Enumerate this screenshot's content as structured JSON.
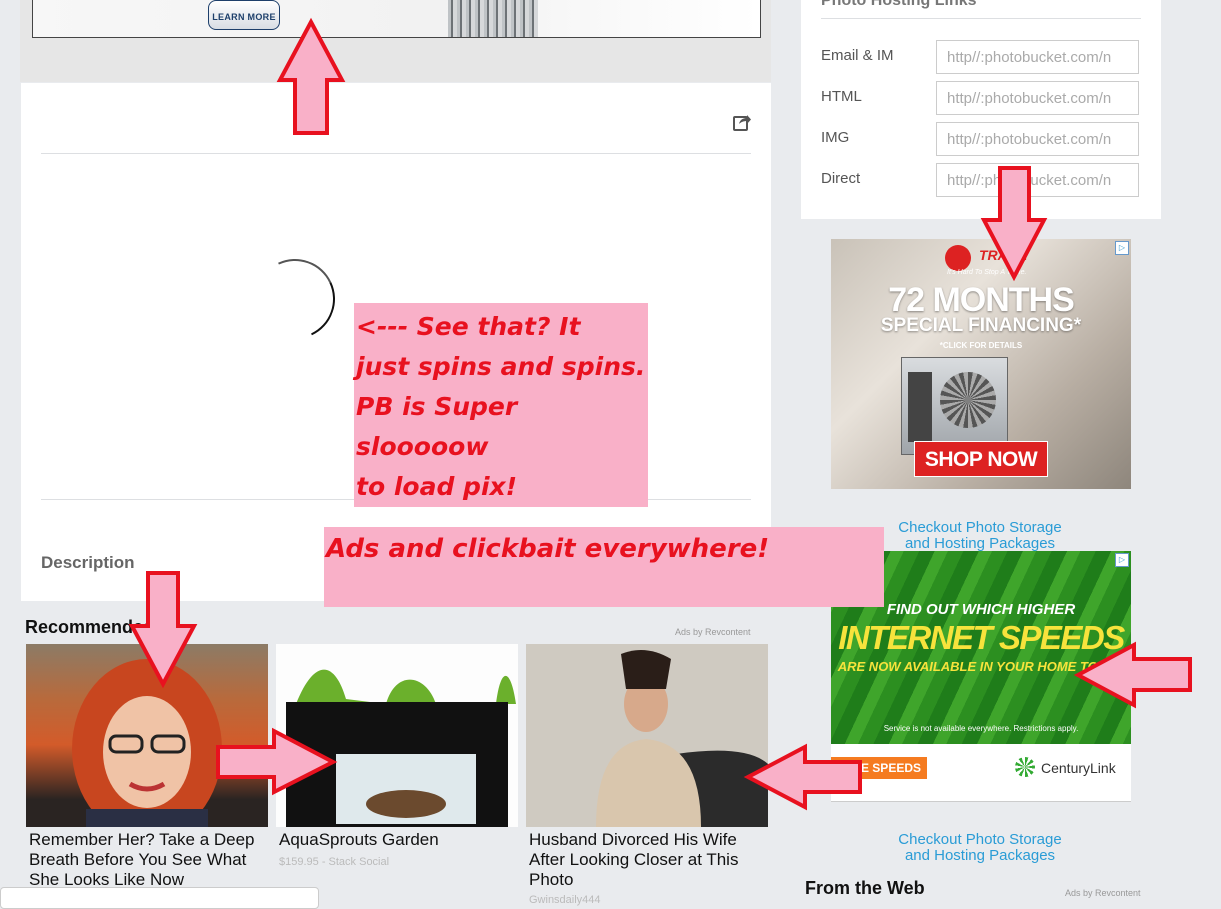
{
  "top_ad": {
    "button_label": "LEARN MORE"
  },
  "photo": {
    "description_label": "Description"
  },
  "hosting_links": {
    "title": "Photo Hosting Links",
    "rows": [
      {
        "label": "Email & IM",
        "value": "http//:photobucket.com/n"
      },
      {
        "label": "HTML",
        "value": "http//:photobucket.com/n"
      },
      {
        "label": "IMG",
        "value": "http//:photobucket.com/n"
      },
      {
        "label": "Direct",
        "value": "http//:photobucket.com/n"
      }
    ]
  },
  "trane_ad": {
    "brand": "TRANE",
    "tagline": "It's Hard To Stop A Trane.",
    "headline": "72 MONTHS",
    "subheadline": "SPECIAL FINANCING*",
    "fine_print": "*CLICK FOR DETAILS",
    "button": "SHOP NOW"
  },
  "checkout_link_1": {
    "line1": "Checkout Photo Storage",
    "line2": "and Hosting Packages"
  },
  "centurylink_ad": {
    "line1": "FIND OUT WHICH HIGHER",
    "line2": "INTERNET SPEEDS",
    "line3": "ARE NOW AVAILABLE IN YOUR HOME TODAY",
    "note": "Service is not available everywhere. Restrictions apply.",
    "button": "E SPEEDS",
    "brand": "CenturyLink"
  },
  "checkout_link_2": {
    "line1": "Checkout Photo Storage",
    "line2": "and Hosting Packages"
  },
  "recommended": {
    "title": "Recommended",
    "ads_by": "Ads by Revcontent",
    "items": [
      {
        "title": "Remember Her? Take a Deep Breath Before You See What She Looks Like Now",
        "sub": ""
      },
      {
        "title": "AquaSprouts Garden",
        "sub": "$159.95 - Stack Social"
      },
      {
        "title": "Husband Divorced His Wife After Looking Closer at This Photo",
        "sub": "Gwinsdaily444"
      }
    ]
  },
  "from_web": {
    "title": "From the Web",
    "ads_by": "Ads by Revcontent"
  },
  "annotations": {
    "note1_lines": [
      "<--- See that? It",
      "just spins and spins.",
      "PB is Super slooooow",
      "to load pix!"
    ],
    "note2": "Ads and clickbait everywhere!"
  },
  "colors": {
    "annotation_bg": "#f9b0c8",
    "annotation_text": "#e8111f",
    "arrow_fill": "#f9b0c8",
    "arrow_stroke": "#e8111f",
    "link": "#2a9cd6"
  }
}
